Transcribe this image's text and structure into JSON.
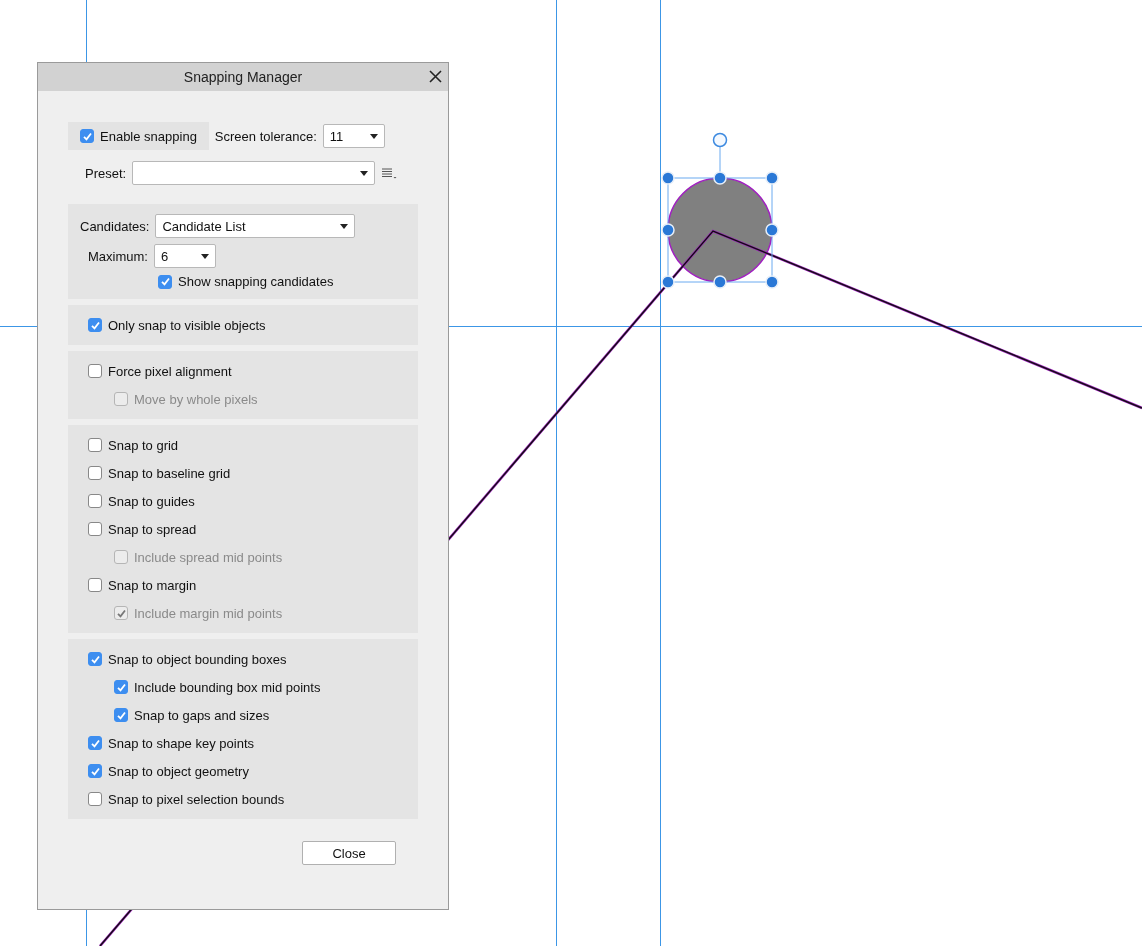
{
  "dialog": {
    "title": "Snapping Manager",
    "enable_snapping": {
      "label": "Enable snapping",
      "checked": true
    },
    "screen_tolerance": {
      "label": "Screen tolerance:",
      "value": "11"
    },
    "preset": {
      "label": "Preset:"
    },
    "candidates": {
      "label": "Candidates:",
      "value": "Candidate List"
    },
    "maximum": {
      "label": "Maximum:",
      "value": "6"
    },
    "show_candidates": {
      "label": "Show snapping candidates",
      "checked": true,
      "disabled": false
    },
    "sections": [
      {
        "options": [
          {
            "label": "Only snap to visible objects",
            "checked": true,
            "disabled": false
          }
        ]
      },
      {
        "options": [
          {
            "label": "Force pixel alignment",
            "checked": false,
            "disabled": false,
            "children": [
              {
                "label": "Move by whole pixels",
                "checked": false,
                "disabled": true
              }
            ]
          }
        ]
      },
      {
        "options": [
          {
            "label": "Snap to grid",
            "checked": false,
            "disabled": false
          },
          {
            "label": "Snap to baseline grid",
            "checked": false,
            "disabled": false
          },
          {
            "label": "Snap to guides",
            "checked": false,
            "disabled": false
          },
          {
            "label": "Snap to spread",
            "checked": false,
            "disabled": false,
            "children": [
              {
                "label": "Include spread mid points",
                "checked": false,
                "disabled": true
              }
            ]
          },
          {
            "label": "Snap to margin",
            "checked": false,
            "disabled": false,
            "children": [
              {
                "label": "Include margin mid points",
                "checked": true,
                "disabled": true
              }
            ]
          }
        ]
      },
      {
        "options": [
          {
            "label": "Snap to object bounding boxes",
            "checked": true,
            "disabled": false,
            "children": [
              {
                "label": "Include bounding box mid points",
                "checked": true,
                "disabled": false
              },
              {
                "label": "Snap to gaps and sizes",
                "checked": true,
                "disabled": false
              }
            ]
          },
          {
            "label": "Snap to shape key points",
            "checked": true,
            "disabled": false
          },
          {
            "label": "Snap to object geometry",
            "checked": true,
            "disabled": false
          },
          {
            "label": "Snap to pixel selection bounds",
            "checked": false,
            "disabled": false
          }
        ]
      }
    ],
    "close_button": "Close"
  }
}
